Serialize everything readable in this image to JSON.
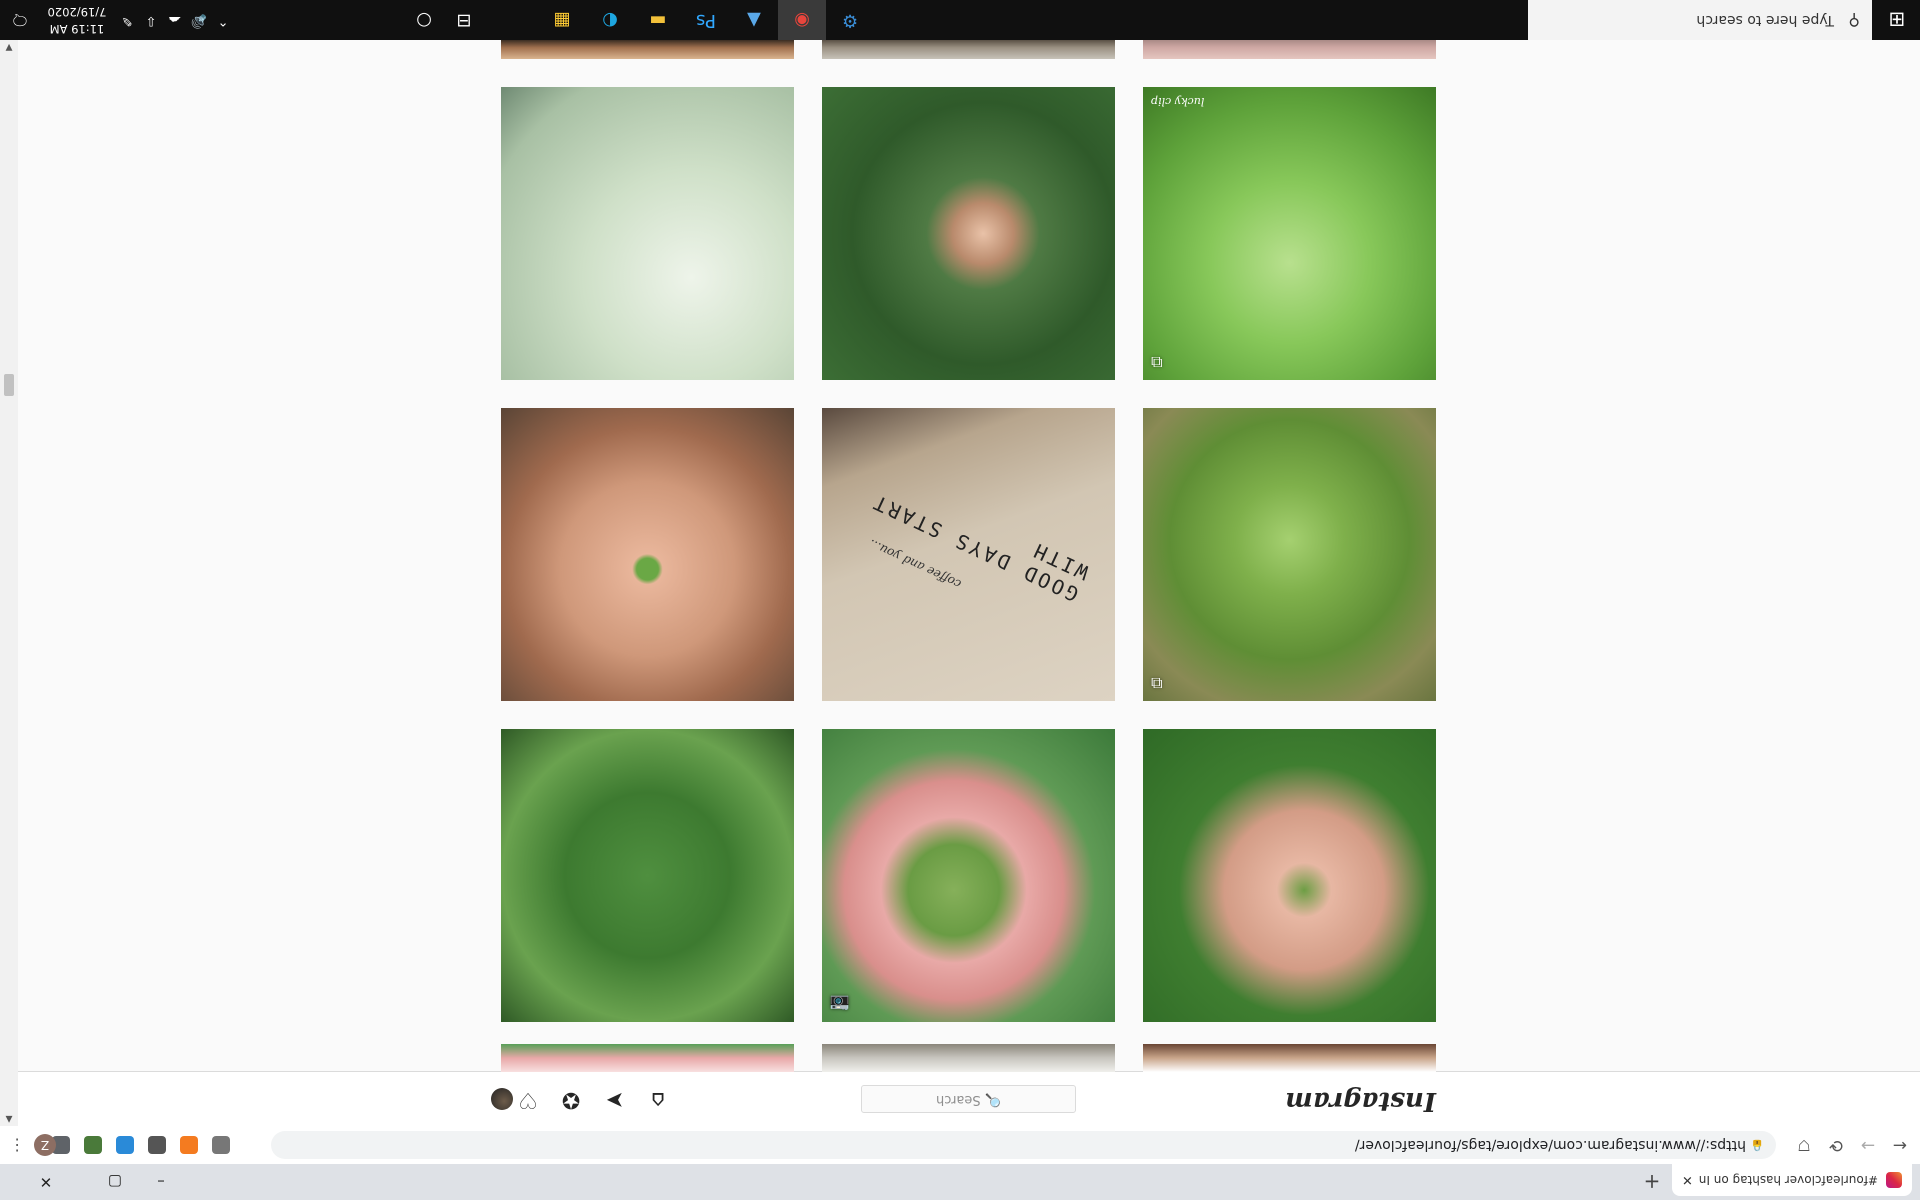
{
  "browser": {
    "tab_title": "#fourleafclover hashtag on Insta",
    "tab_close": "✕",
    "new_tab": "+",
    "url": "https://www.instagram.com/explore/tags/fourleafclover/",
    "profile_initial": "Z",
    "menu_glyph": "⋮",
    "back_glyph": "←",
    "forward_glyph": "→",
    "reload_glyph": "⟳",
    "window_controls": {
      "minimize": "–",
      "maximize": "▢",
      "close": "✕"
    },
    "extensions": [
      {
        "name": "grey-extension-icon",
        "color": "#777777"
      },
      {
        "name": "orange-extension-icon",
        "color": "#f47b20"
      },
      {
        "name": "dark-extension-icon",
        "color": "#555555"
      },
      {
        "name": "blue-extension-icon",
        "color": "#2a8ad8"
      },
      {
        "name": "green-extension-icon",
        "color": "#4a7a3a"
      },
      {
        "name": "puzzle-extension-icon",
        "color": "#5f6368"
      }
    ]
  },
  "instagram": {
    "logo": "Instagram",
    "search_placeholder": "🔍 Search",
    "nav": {
      "home": "⌂",
      "direct": "➤",
      "explore": "✪",
      "activity": "♡"
    }
  },
  "posts": [
    {
      "alt": "pale white clover leaves",
      "bg": "radial-gradient(circle at 35% 35%, #eef4ea 0%, #cfe0c8 40%, #a8c0a4 80%, #6f8a73 100%)",
      "badge": ""
    },
    {
      "alt": "hand holding four leaf clover over clover patch",
      "bg": "radial-gradient(circle at 45% 50%, #e9c2a8 0%, #b98a6c 14%, #4f7a44 26%, #2f5a2a 60%, #3c6e35 100%)",
      "badge": ""
    },
    {
      "alt": "bright green clover patch",
      "bg": "radial-gradient(circle at 50% 40%, #b8e08e 0%, #88c85a 35%, #5ea23a 70%, #3e7a25 100%)",
      "badge": "⧉",
      "watermark": "lucky clip"
    },
    {
      "alt": "cupped hands holding small four leaf clover",
      "bg": "radial-gradient(circle at 50% 45%, #6aa845 0%, #6aa845 5%, #e8b59a 7%, #cf987a 40%, #a06a4e 65%, #5a4536 100%)",
      "badge": ""
    },
    {
      "alt": "beige shirt with text",
      "bg": "linear-gradient(160deg, #ddd3c3 0%, #d2c6b3 55%, #b7a58d 80%, #5a4a3f 100%)",
      "badge": "",
      "text": "GOOD DAYS START WITH",
      "subtext": "coffee and you..."
    },
    {
      "alt": "four leaf clover in grass",
      "bg": "radial-gradient(circle at 50% 55%, #a5d070 0%, #7fb04b 25%, #5f8e35 55%, #8a8a55 80%, #6a7540 100%)",
      "badge": "⧉"
    },
    {
      "alt": "clover among tall grass and white flowers",
      "bg": "radial-gradient(circle at 50% 50%, #4f8f3f 0%, #3d7a30 40%, #6aa24f 70%, #2f5a26 100%)",
      "badge": ""
    },
    {
      "alt": "fingers holding a four leaf clover",
      "bg": "radial-gradient(circle at 55% 45%, #86b05a 0%, #6a9c44 20%, #e8a9a7 32%, #d98f8c 48%, #5f9a55 62%, #3c7a3a 100%)",
      "badge": "📷"
    },
    {
      "alt": "palm holding clover over clover patch",
      "bg": "radial-gradient(circle at 45% 45%, #6d9e44 0%, #e7b7a3 12%, #d39c86 35%, #3f7e30 55%, #2f6a26 100%)",
      "badge": ""
    },
    {
      "alt": "partially visible post",
      "bg": "linear-gradient(180deg, #d9b48f 0%, #a0704e 60%, #3a2c22 100%)",
      "badge": ""
    },
    {
      "alt": "partially visible post",
      "bg": "linear-gradient(180deg, #c7c2b8 0%, #9a9082 60%, #5a5045 100%)",
      "badge": ""
    },
    {
      "alt": "partially visible post",
      "bg": "linear-gradient(180deg, #e5c6c0 0%, #cfa8a4 60%, #a98a86 100%)",
      "badge": ""
    },
    {
      "alt": "partially visible post",
      "bg": "linear-gradient(180deg, #ffffff 0%, #c9a58a 50%, #6a4634 100%)",
      "badge": ""
    },
    {
      "alt": "partially visible post",
      "bg": "linear-gradient(180deg, #f0f0ec 0%, #c8c6bf 50%, #8a857a 100%)",
      "badge": ""
    },
    {
      "alt": "partially visible post",
      "bg": "linear-gradient(180deg, #f8e0e0 0%, #e8a8a8 50%, #58a058 100%)",
      "badge": ""
    }
  ],
  "taskbar": {
    "start_glyph": "⊞",
    "search_placeholder": "Type here to search",
    "search_glyph": "⚲",
    "cortana_glyph": "○",
    "taskview_glyph": "⊟",
    "apps": [
      {
        "name": "microsoft-store-icon",
        "glyph": "▦",
        "color": "#ffcc33"
      },
      {
        "name": "edge-icon",
        "glyph": "◐",
        "color": "#1ea6e0"
      },
      {
        "name": "file-explorer-icon",
        "glyph": "▬",
        "color": "#f3c13a"
      },
      {
        "name": "photoshop-icon",
        "glyph": "Ps",
        "color": "#31a8ff"
      },
      {
        "name": "photos-icon",
        "glyph": "▲",
        "color": "#5aa8e8"
      },
      {
        "name": "chrome-icon",
        "glyph": "◉",
        "color": "#e8453c"
      },
      {
        "name": "settings-sync-icon",
        "glyph": "⚙",
        "color": "#3a8ed8"
      }
    ],
    "tray_glyphs": [
      "⌃",
      "🔊",
      "☁",
      "⇩",
      "✎"
    ],
    "time": "11:19 AM",
    "date": "7/19/2020",
    "notification_glyph": "🗨"
  }
}
